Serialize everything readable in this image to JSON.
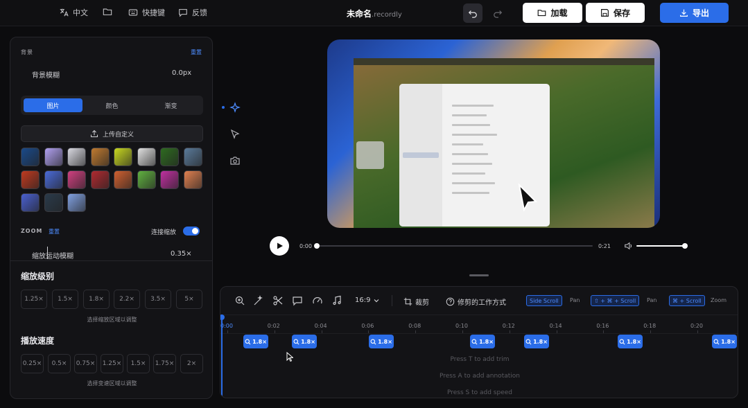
{
  "topbar": {
    "language_label": "中文",
    "shortcuts_label": "快捷键",
    "feedback_label": "反馈",
    "title": "未命名",
    "title_ext": ".recordly",
    "load_label": "加载",
    "save_label": "保存",
    "export_label": "导出"
  },
  "background": {
    "section_title": "背景",
    "reset_label": "重置",
    "blur_label": "背景模糊",
    "blur_value": "0.0px",
    "tabs": [
      "图片",
      "颜色",
      "渐变"
    ],
    "active_tab": "图片",
    "upload_label": "上传自定义",
    "thumbnails": [
      {
        "icon": "wallpaper-blue-dark",
        "color": "#1a4a8a"
      },
      {
        "icon": "wallpaper-holo",
        "color": "#b0a0f0"
      },
      {
        "icon": "wallpaper-white-waves",
        "color": "#d8d8e0"
      },
      {
        "icon": "wallpaper-orange-stripes",
        "color": "#c07a30"
      },
      {
        "icon": "wallpaper-yellow-green",
        "color": "#c8d820"
      },
      {
        "icon": "wallpaper-white-pattern",
        "color": "#e0e0e0"
      },
      {
        "icon": "wallpaper-green-leaf",
        "color": "#2e6a20"
      },
      {
        "icon": "wallpaper-mountain",
        "color": "#5a7a9a"
      },
      {
        "icon": "wallpaper-red-dark",
        "color": "#c03a20"
      },
      {
        "icon": "wallpaper-blue-orange",
        "color": "#4a6ad8"
      },
      {
        "icon": "wallpaper-red-purple",
        "color": "#d04080"
      },
      {
        "icon": "wallpaper-red-dune",
        "color": "#b02a30"
      },
      {
        "icon": "wallpaper-sunset",
        "color": "#d06030"
      },
      {
        "icon": "wallpaper-green-hills",
        "color": "#60b040"
      },
      {
        "icon": "wallpaper-magenta",
        "color": "#c030a0"
      },
      {
        "icon": "wallpaper-peach",
        "color": "#e08050"
      },
      {
        "icon": "wallpaper-blue-purple",
        "color": "#4a60d0"
      },
      {
        "icon": "wallpaper-dark-landscape",
        "color": "#2a3a4a"
      },
      {
        "icon": "wallpaper-pastel",
        "color": "#80a0e0"
      }
    ]
  },
  "zoom": {
    "section_title": "ZOOM",
    "reset_label": "重置",
    "connect_label": "连接缩放",
    "connect_on": true,
    "motion_blur_label": "缩放运动模糊",
    "motion_blur_value": "0.35×",
    "level_title": "缩放级别",
    "levels": [
      "1.25×",
      "1.5×",
      "1.8×",
      "2.2×",
      "3.5×",
      "5×"
    ],
    "level_hint": "选择缩放区域以调整",
    "speed_title": "播放速度",
    "speeds": [
      "0.25×",
      "0.5×",
      "0.75×",
      "1.25×",
      "1.5×",
      "1.75×",
      "2×"
    ],
    "speed_hint": "选择变速区域以调整"
  },
  "player": {
    "current_time": "0:00",
    "duration": "0:21",
    "progress": 0.0,
    "volume": 1.0
  },
  "timeline": {
    "aspect_label": "16:9",
    "crop_label": "裁剪",
    "how_label": "修剪的工作方式",
    "kbd1": "Side Scroll",
    "kbd1_after": "Pan",
    "kbd2": "⇧ + ⌘ + Scroll",
    "kbd2_after": "Pan",
    "kbd3": "⌘ + Scroll",
    "kbd3_after": "Zoom",
    "ticks": [
      "0:00",
      "0:02",
      "0:04",
      "0:06",
      "0:08",
      "0:10",
      "0:12",
      "0:14",
      "0:16",
      "0:18",
      "0:20"
    ],
    "zoom_segments": [
      "1.8×",
      "1.8×",
      "1.8×",
      "1.8×",
      "1.8×",
      "1.8×",
      "1.8×"
    ],
    "hint_trim": "Press T to add trim",
    "hint_annotation": "Press A to add annotation",
    "hint_speed": "Press S to add speed"
  }
}
